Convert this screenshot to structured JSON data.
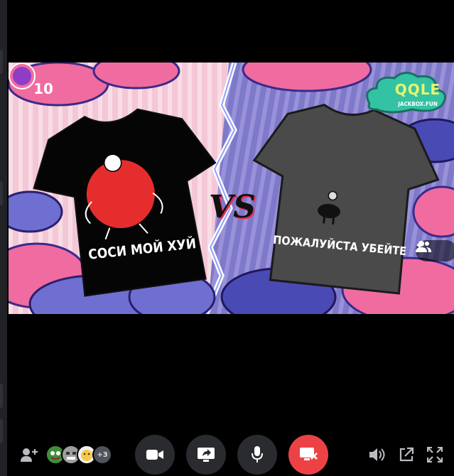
{
  "game": {
    "round": "10",
    "brand_title": "QQLE",
    "brand_site": "JACKBOX.FUN",
    "versus": "VS",
    "shirt_left_text": "СОСИ МОЙ ХУЙ",
    "shirt_right_text": "ПОЖАЛУЙСТА УБЕЙТЕ"
  },
  "call": {
    "extra_participants": "+3",
    "colors": {
      "control_bg": "#292b2f",
      "end_call": "#ed4245",
      "shirt_left": "#000000",
      "shirt_right": "#4a4a4a",
      "circle": "#e52d2d"
    }
  }
}
